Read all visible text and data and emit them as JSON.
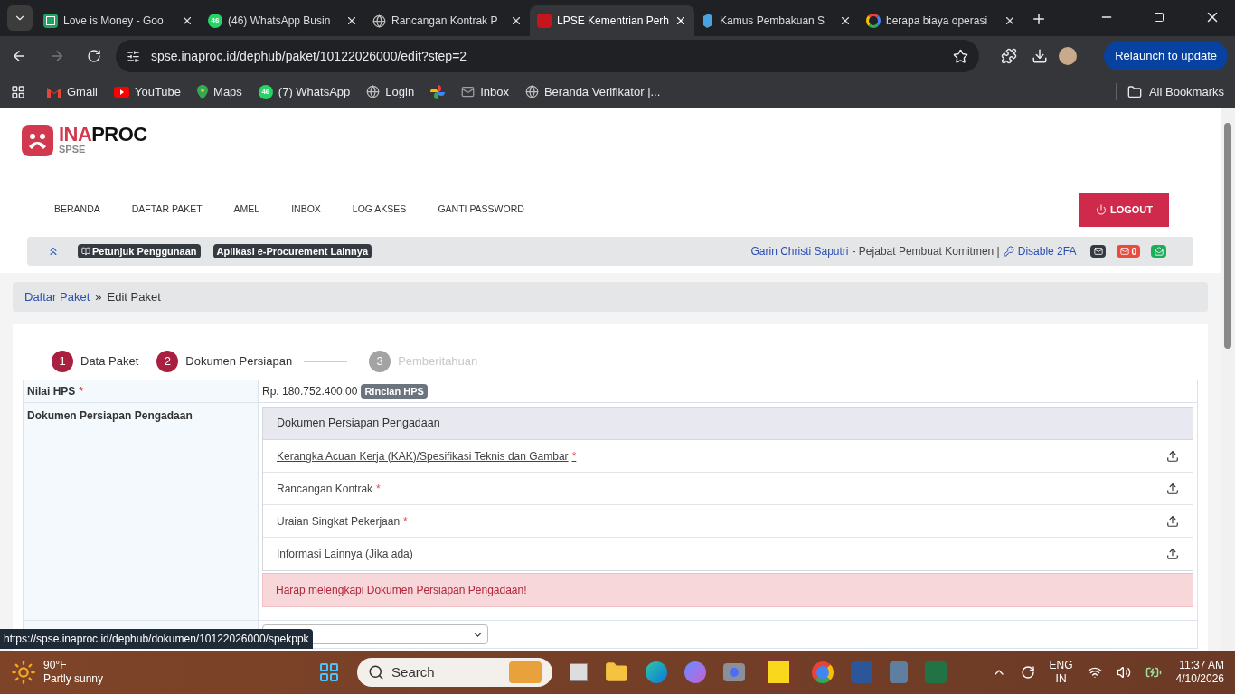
{
  "browser": {
    "tabs": [
      {
        "title": "Love is Money - Goo",
        "kind": "sheets",
        "selected": false
      },
      {
        "title": "(46) WhatsApp Busin",
        "kind": "whatsapp",
        "badge": "46",
        "selected": false
      },
      {
        "title": "Rancangan Kontrak P",
        "kind": "globe",
        "selected": false
      },
      {
        "title": "LPSE Kementrian Perh",
        "kind": "lpse",
        "selected": true
      },
      {
        "title": "Kamus Pembakuan S",
        "kind": "kamus",
        "selected": false
      },
      {
        "title": "berapa biaya operasi",
        "kind": "google",
        "selected": false
      }
    ],
    "url": "spse.inaproc.id/dephub/paket/10122026000/edit?step=2",
    "relaunch": "Relaunch to update",
    "bookmarks": [
      {
        "label": "Gmail",
        "kind": "gmail"
      },
      {
        "label": "YouTube",
        "kind": "youtube"
      },
      {
        "label": "Maps",
        "kind": "maps"
      },
      {
        "label": "(7) WhatsApp",
        "kind": "whatsapp",
        "badge": "46"
      },
      {
        "label": "Login",
        "kind": "globe"
      },
      {
        "kind": "pinwheel"
      },
      {
        "label": "Inbox",
        "kind": "mail"
      },
      {
        "label": "Beranda Verifikator |...",
        "kind": "globe"
      }
    ],
    "all_bookmarks": "All Bookmarks"
  },
  "page": {
    "logo": {
      "accent": "INA",
      "main": "PROC",
      "sub": "SPSE"
    },
    "nav": [
      "BERANDA",
      "DAFTAR PAKET",
      "AMEL",
      "INBOX",
      "LOG AKSES",
      "GANTI PASSWORD"
    ],
    "logout": "LOGOUT",
    "toolbar": {
      "buttons": [
        "Petunjuk Penggunaan",
        "Aplikasi e-Procurement Lainnya"
      ],
      "user": "Garin Christi Saputri",
      "role": "- Pejabat Pembuat Komitmen |",
      "disable_2fa": "Disable 2FA",
      "unread_count": "0"
    },
    "breadcrumb": [
      "Daftar Paket",
      "Edit Paket"
    ],
    "breadcrumb_separator": "»",
    "required_mark": "*",
    "steps": [
      {
        "number": "1",
        "label": "Data Paket",
        "reached": true
      },
      {
        "number": "2",
        "label": "Dokumen Persiapan",
        "reached": true
      },
      {
        "number": "3",
        "label": "Pemberitahuan",
        "reached": false
      }
    ],
    "hps": {
      "label": "Nilai HPS",
      "required": true,
      "value": "Rp. 180.752.400,00",
      "badge": "Rincian HPS"
    },
    "documents": {
      "label": "Dokumen Persiapan Pengadaan",
      "panel_title": "Dokumen Persiapan Pengadaan",
      "items": [
        {
          "label": "Kerangka Acuan Kerja (KAK)/Spesifikasi Teknis dan Gambar",
          "required": true,
          "hovered": true
        },
        {
          "label": "Rancangan Kontrak",
          "required": true,
          "hovered": false
        },
        {
          "label": "Uraian Singkat Pekerjaan",
          "required": true,
          "hovered": false
        },
        {
          "label": "Informasi Lainnya (Jika ada)",
          "required": false,
          "hovered": false
        }
      ],
      "alert": "Harap melengkapi Dokumen Persiapan Pengadaan!"
    },
    "status_url": "https://spse.inaproc.id/dephub/dokumen/10122026000/spekppk"
  },
  "taskbar": {
    "temperature": "90°F",
    "weather": "Partly sunny",
    "search": "Search",
    "language": "ENG",
    "region": "IN",
    "time": "11:37 AM",
    "date": "4/10/2026"
  }
}
